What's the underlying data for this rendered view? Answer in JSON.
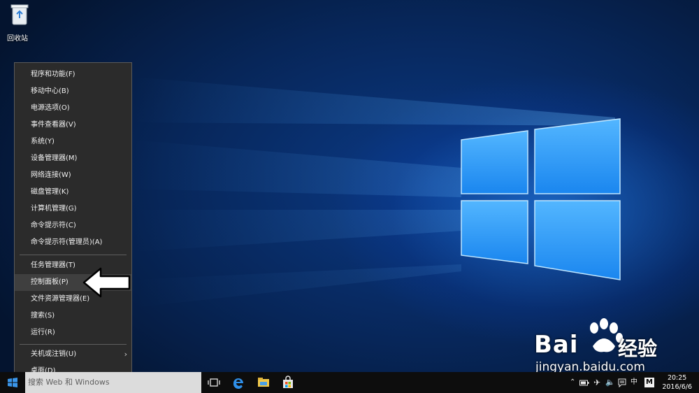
{
  "desktop": {
    "recycle_bin_label": "回收站"
  },
  "context_menu": {
    "items": [
      {
        "label": "程序和功能(F)"
      },
      {
        "label": "移动中心(B)"
      },
      {
        "label": "电源选项(O)"
      },
      {
        "label": "事件查看器(V)"
      },
      {
        "label": "系统(Y)"
      },
      {
        "label": "设备管理器(M)"
      },
      {
        "label": "网络连接(W)"
      },
      {
        "label": "磁盘管理(K)"
      },
      {
        "label": "计算机管理(G)"
      },
      {
        "label": "命令提示符(C)"
      },
      {
        "label": "命令提示符(管理员)(A)"
      },
      {
        "label": "任务管理器(T)"
      },
      {
        "label": "控制面板(P)",
        "highlighted": true
      },
      {
        "label": "文件资源管理器(E)"
      },
      {
        "label": "搜索(S)"
      },
      {
        "label": "运行(R)"
      },
      {
        "label": "关机或注销(U)",
        "submenu": true
      },
      {
        "label": "桌面(D)"
      }
    ]
  },
  "taskbar": {
    "search_text": "搜索 Web 和 Windows",
    "tray": {
      "ime": "中",
      "ime_mode": "M"
    },
    "clock": {
      "time": "20:25",
      "date": "2016/6/6"
    }
  },
  "watermark": {
    "brand_left": "Bai",
    "brand_right": "经验",
    "url": "jingyan.baidu.com"
  },
  "colors": {
    "menu_bg": "#2b2b2b",
    "menu_highlight": "#3f3f3f",
    "taskbar_bg": "#0d0d0d",
    "accent_blue": "#0078d7"
  }
}
